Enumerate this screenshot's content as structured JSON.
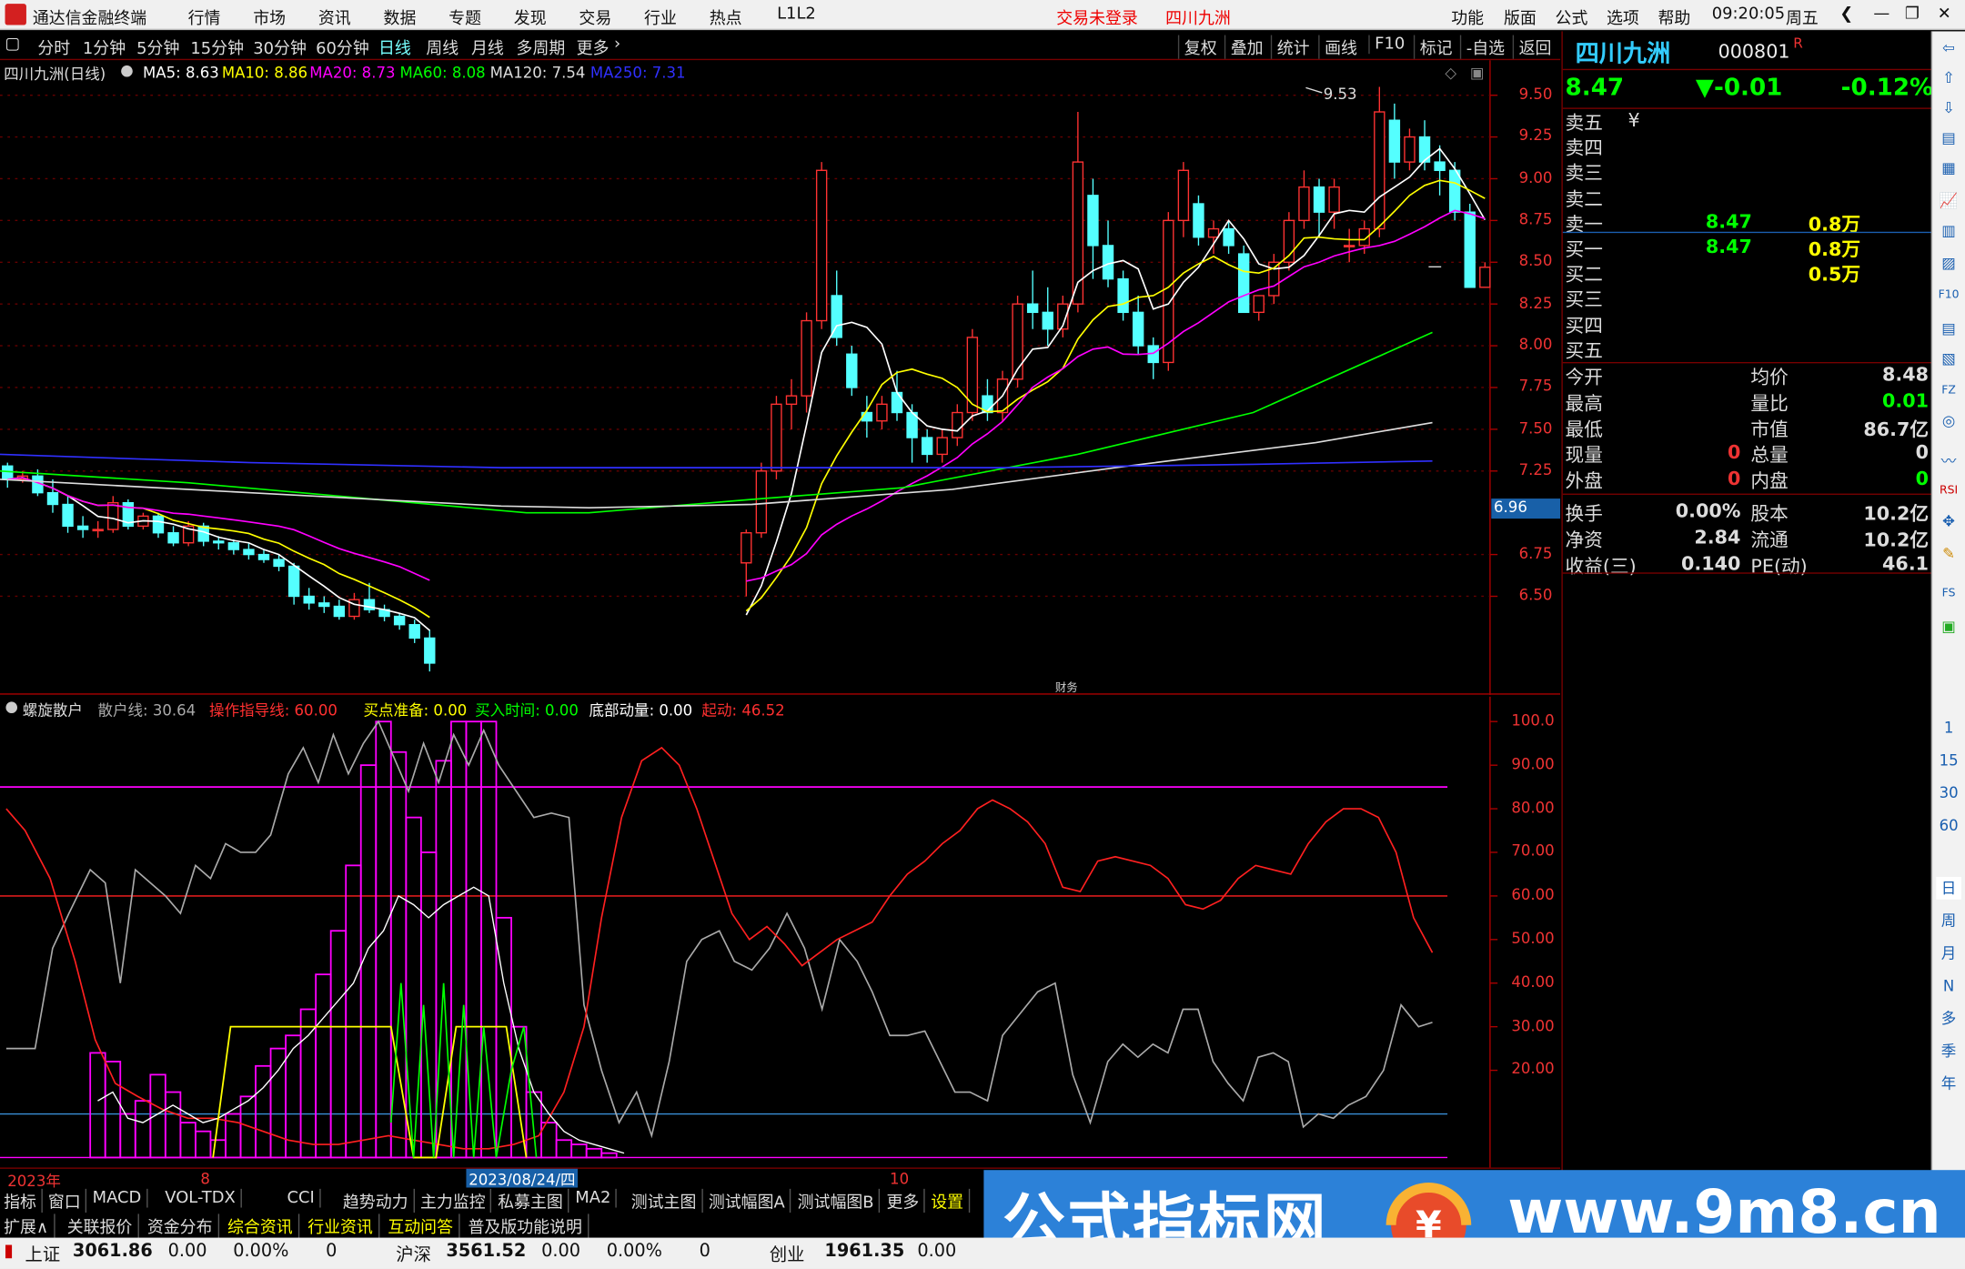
{
  "menu": {
    "app_title": "通达信金融终端",
    "items": [
      "行情",
      "市场",
      "资讯",
      "数据",
      "专题",
      "发现",
      "交易",
      "行业",
      "热点",
      "L1L2"
    ],
    "login": "交易未登录",
    "stock": "四川九洲",
    "right": [
      "功能",
      "版面",
      "公式",
      "选项",
      "帮助"
    ],
    "time": "09:20:05",
    "weekday": "周五"
  },
  "toolbar": {
    "periods": [
      "分时",
      "1分钟",
      "5分钟",
      "15分钟",
      "30分钟",
      "60分钟",
      "日线",
      "周线",
      "月线",
      "多周期",
      "更多"
    ],
    "active": "日线",
    "right": [
      "复权",
      "叠加",
      "统计",
      "画线",
      "F10",
      "标记",
      "-自选",
      "返回"
    ]
  },
  "main": {
    "title": "四川九洲(日线)",
    "ma": [
      {
        "label": "MA5: 8.63",
        "color": "#ffffff"
      },
      {
        "label": "MA10: 8.86",
        "color": "#ffff00"
      },
      {
        "label": "MA20: 8.73",
        "color": "#ff00ff"
      },
      {
        "label": "MA60: 8.08",
        "color": "#00ff00"
      },
      {
        "label": "MA120: 7.54",
        "color": "#dddddd"
      },
      {
        "label": "MA250: 7.31",
        "color": "#3030ff"
      }
    ],
    "price_ticks": [
      "9.50",
      "9.25",
      "9.00",
      "8.75",
      "8.50",
      "8.25",
      "8.00",
      "7.75",
      "7.50",
      "7.25",
      "6.75",
      "6.50"
    ],
    "high_label": "9.53",
    "low_label": "6.96",
    "marker": "财务"
  },
  "sub": {
    "title": "螺旋散户",
    "fields": [
      {
        "label": "散户线: 30.64",
        "color": "#aaaaaa"
      },
      {
        "label": "操作指导线: 60.00",
        "color": "#ff3030"
      },
      {
        "label": "买点准备: 0.00",
        "color": "#ffff00"
      },
      {
        "label": "买入时间: 0.00",
        "color": "#00ff00"
      },
      {
        "label": "底部动量: 0.00",
        "color": "#ffffff"
      },
      {
        "label": "起动: 46.52",
        "color": "#ff3030"
      }
    ],
    "ticks": [
      "100.0",
      "90.00",
      "80.00",
      "70.00",
      "60.00",
      "50.00",
      "40.00",
      "30.00",
      "20.00"
    ]
  },
  "dates": {
    "year": "2023年",
    "m8": "8",
    "cursor": "2023/08/24/四",
    "m10": "10"
  },
  "quote": {
    "name": "四川九洲",
    "code": "000801",
    "price": "8.47",
    "change": "▼-0.01",
    "pct": "-0.12%",
    "book": [
      {
        "label": "卖五",
        "price": "",
        "vol": "",
        "mark": "¥"
      },
      {
        "label": "卖四",
        "price": "",
        "vol": ""
      },
      {
        "label": "卖三",
        "price": "",
        "vol": ""
      },
      {
        "label": "卖二",
        "price": "",
        "vol": ""
      },
      {
        "label": "卖一",
        "price": "8.47",
        "vol": "0.8万"
      },
      {
        "label": "买一",
        "price": "8.47",
        "vol": "0.8万"
      },
      {
        "label": "买二",
        "price": "",
        "vol": "0.5万"
      },
      {
        "label": "买三",
        "price": "",
        "vol": ""
      },
      {
        "label": "买四",
        "price": "",
        "vol": ""
      },
      {
        "label": "买五",
        "price": "",
        "vol": ""
      }
    ],
    "stats": [
      [
        "今开",
        "",
        "均价",
        "8.48"
      ],
      [
        "最高",
        "",
        "量比",
        "0.01"
      ],
      [
        "最低",
        "",
        "市值",
        "86.7亿"
      ],
      [
        "现量",
        "0",
        "总量",
        "0"
      ],
      [
        "外盘",
        "0",
        "内盘",
        "0"
      ],
      [
        "换手",
        "0.00%",
        "股本",
        "10.2亿"
      ],
      [
        "净资",
        "2.84",
        "流通",
        "10.2亿"
      ],
      [
        "收益(三)",
        "0.140",
        "PE(动)",
        "46.1"
      ]
    ]
  },
  "tabs1": [
    "指标",
    "窗口",
    "MACD",
    "VOL-TDX",
    "CCI",
    "趋势动力",
    "主力监控",
    "私募主图",
    "MA2",
    "测试主图",
    "测试幅图A",
    "测试幅图B",
    "更多",
    "设置"
  ],
  "tabs2": [
    "扩展∧",
    "关联报价",
    "资金分布",
    "综合资讯",
    "行业资讯",
    "互动问答",
    "普及版功能说明"
  ],
  "status": {
    "sh_label": "上证",
    "sh_value": "3061.86",
    "sh_chg": "0.00",
    "sh_pct": "0.00%",
    "sh_vol": "0",
    "hs_label": "沪深",
    "hs_value": "3561.52",
    "hs_chg": "0.00",
    "hs_pct": "0.00%",
    "hs_vol": "0",
    "cy_label": "创业",
    "cy_value": "1961.35",
    "cy_chg": "0.00"
  },
  "watermark": {
    "text1": "公式指标网",
    "text2": "www.9m8.cn"
  },
  "strip": [
    "1",
    "15",
    "30",
    "60",
    "日",
    "周",
    "月",
    "N",
    "多",
    "季",
    "年"
  ],
  "chart_data": [
    {
      "type": "candlestick",
      "title": "四川九洲(日线)",
      "ylim": [
        6.3,
        9.6
      ],
      "ohlc": [
        [
          7.28,
          7.3,
          7.15,
          7.2
        ],
        [
          7.2,
          7.25,
          7.18,
          7.22
        ],
        [
          7.22,
          7.26,
          7.1,
          7.12
        ],
        [
          7.12,
          7.2,
          7.0,
          7.05
        ],
        [
          7.05,
          7.1,
          6.88,
          6.92
        ],
        [
          6.92,
          6.98,
          6.85,
          6.9
        ],
        [
          6.9,
          6.95,
          6.85,
          6.9
        ],
        [
          6.9,
          7.1,
          6.88,
          7.06
        ],
        [
          7.06,
          7.08,
          6.9,
          6.92
        ],
        [
          6.92,
          7.0,
          6.9,
          6.98
        ],
        [
          6.98,
          7.0,
          6.85,
          6.88
        ],
        [
          6.88,
          6.92,
          6.8,
          6.82
        ],
        [
          6.82,
          6.95,
          6.8,
          6.92
        ],
        [
          6.92,
          6.94,
          6.8,
          6.83
        ],
        [
          6.83,
          6.86,
          6.78,
          6.82
        ],
        [
          6.82,
          6.84,
          6.75,
          6.78
        ],
        [
          6.78,
          6.82,
          6.72,
          6.75
        ],
        [
          6.75,
          6.78,
          6.7,
          6.72
        ],
        [
          6.72,
          6.75,
          6.65,
          6.68
        ],
        [
          6.68,
          6.7,
          6.45,
          6.5
        ],
        [
          6.5,
          6.55,
          6.42,
          6.46
        ],
        [
          6.46,
          6.5,
          6.4,
          6.44
        ],
        [
          6.44,
          6.48,
          6.36,
          6.38
        ],
        [
          6.38,
          6.52,
          6.36,
          6.48
        ],
        [
          6.48,
          6.58,
          6.4,
          6.42
        ],
        [
          6.42,
          6.45,
          6.35,
          6.38
        ],
        [
          6.38,
          6.4,
          6.3,
          6.33
        ],
        [
          6.33,
          6.36,
          6.22,
          6.25
        ],
        [
          6.25,
          6.3,
          6.05,
          6.1
        ],
        null,
        null,
        null,
        null,
        null,
        null,
        null,
        null,
        null,
        null,
        null,
        null,
        null,
        null,
        null,
        null,
        null,
        null,
        null,
        null,
        [
          6.7,
          6.9,
          6.5,
          6.88
        ],
        [
          6.88,
          7.3,
          6.85,
          7.25
        ],
        [
          7.25,
          7.7,
          7.2,
          7.65
        ],
        [
          7.65,
          7.8,
          7.5,
          7.7
        ],
        [
          7.7,
          8.2,
          7.6,
          8.15
        ],
        [
          8.15,
          9.1,
          8.1,
          9.05
        ],
        [
          8.3,
          8.45,
          8.0,
          8.05
        ],
        [
          7.95,
          8.0,
          7.7,
          7.75
        ],
        [
          7.6,
          7.7,
          7.45,
          7.55
        ],
        [
          7.55,
          7.7,
          7.5,
          7.65
        ],
        [
          7.72,
          7.85,
          7.55,
          7.6
        ],
        [
          7.6,
          7.65,
          7.3,
          7.45
        ],
        [
          7.45,
          7.5,
          7.3,
          7.35
        ],
        [
          7.35,
          7.5,
          7.3,
          7.45
        ],
        [
          7.45,
          7.65,
          7.4,
          7.6
        ],
        [
          7.6,
          8.1,
          7.55,
          8.05
        ],
        [
          7.7,
          7.8,
          7.55,
          7.6
        ],
        [
          7.6,
          7.85,
          7.55,
          7.8
        ],
        [
          7.8,
          8.3,
          7.75,
          8.25
        ],
        [
          8.25,
          8.45,
          8.1,
          8.2
        ],
        [
          8.2,
          8.35,
          8.0,
          8.1
        ],
        [
          8.1,
          8.3,
          8.05,
          8.25
        ],
        [
          8.25,
          9.4,
          8.2,
          9.1
        ],
        [
          8.9,
          9.0,
          8.4,
          8.6
        ],
        [
          8.6,
          8.75,
          8.35,
          8.4
        ],
        [
          8.4,
          8.45,
          8.15,
          8.2
        ],
        [
          8.2,
          8.3,
          7.95,
          8.0
        ],
        [
          8.0,
          8.05,
          7.8,
          7.9
        ],
        [
          7.9,
          8.8,
          7.85,
          8.75
        ],
        [
          8.75,
          9.1,
          8.65,
          9.05
        ],
        [
          8.85,
          8.9,
          8.6,
          8.65
        ],
        [
          8.65,
          8.75,
          8.55,
          8.7
        ],
        [
          8.7,
          8.75,
          8.55,
          8.6
        ],
        [
          8.55,
          8.6,
          8.2,
          8.2
        ],
        [
          8.2,
          8.3,
          8.15,
          8.3
        ],
        [
          8.3,
          8.55,
          8.25,
          8.5
        ],
        [
          8.5,
          8.8,
          8.45,
          8.75
        ],
        [
          8.75,
          9.05,
          8.7,
          8.95
        ],
        [
          8.95,
          9.0,
          8.65,
          8.8
        ],
        [
          8.8,
          9.0,
          8.7,
          8.95
        ],
        [
          8.6,
          8.7,
          8.5,
          8.6
        ],
        [
          8.6,
          8.75,
          8.55,
          8.7
        ],
        [
          8.7,
          9.55,
          8.65,
          9.4
        ],
        [
          9.35,
          9.45,
          9.0,
          9.1
        ],
        [
          9.1,
          9.3,
          9.05,
          9.25
        ],
        [
          9.25,
          9.35,
          9.05,
          9.1
        ],
        [
          9.1,
          9.2,
          8.9,
          9.05
        ],
        [
          9.05,
          9.1,
          8.75,
          8.8
        ],
        [
          8.8,
          8.85,
          8.35,
          8.35
        ],
        [
          8.35,
          8.5,
          8.35,
          8.47
        ]
      ]
    },
    {
      "type": "line",
      "title": "螺旋散户",
      "ylim": [
        0,
        100
      ]
    }
  ]
}
